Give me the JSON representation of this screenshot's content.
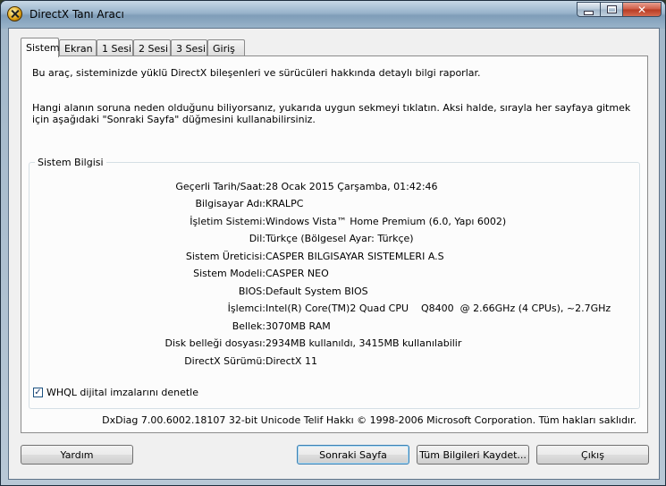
{
  "window": {
    "title": "DirectX Tanı Aracı"
  },
  "tabs": [
    {
      "label": "Sistem",
      "active": true
    },
    {
      "label": "Ekran"
    },
    {
      "label": "1 Sesi"
    },
    {
      "label": "2 Sesi"
    },
    {
      "label": "3 Sesi"
    },
    {
      "label": "Giriş"
    }
  ],
  "intro": {
    "line1": "Bu araç, sisteminizde yüklü DirectX bileşenleri ve sürücüleri hakkında detaylı bilgi raporlar.",
    "line2": "Hangi alanın soruna neden olduğunu biliyorsanız, yukarıda uygun sekmeyi tıklatın.  Aksi halde, sırayla her sayfaya gitmek için aşağıdaki \"Sonraki Sayfa\" düğmesini kullanabilirsiniz."
  },
  "system_info": {
    "title": "Sistem Bilgisi",
    "rows": [
      {
        "label": "Geçerli Tarih/Saat:",
        "value": "28 Ocak 2015 Çarşamba, 01:42:46"
      },
      {
        "label": "Bilgisayar Adı:",
        "value": "KRALPC"
      },
      {
        "label": "İşletim Sistemi:",
        "value": "Windows Vista™ Home Premium (6.0, Yapı 6002)"
      },
      {
        "label": "Dil:",
        "value": "Türkçe (Bölgesel Ayar: Türkçe)"
      },
      {
        "label": "Sistem Üreticisi:",
        "value": "CASPER BILGISAYAR SISTEMLERI A.S"
      },
      {
        "label": "Sistem Modeli:",
        "value": "CASPER NEO"
      },
      {
        "label": "BIOS:",
        "value": "Default System BIOS"
      },
      {
        "label": "İşlemci:",
        "value": "Intel(R) Core(TM)2 Quad CPU    Q8400  @ 2.66GHz (4 CPUs), ~2.7GHz"
      },
      {
        "label": "Bellek:",
        "value": "3070MB RAM"
      },
      {
        "label": "Disk belleği dosyası:",
        "value": "2934MB kullanıldı, 3415MB kullanılabilir"
      },
      {
        "label": "DirectX Sürümü:",
        "value": "DirectX 11"
      }
    ]
  },
  "whql": {
    "label": "WHQL dijital imzalarını denetle",
    "checked": true
  },
  "copyright": "DxDiag 7.00.6002.18107 32-bit Unicode  Telif Hakkı © 1998-2006 Microsoft Corporation.  Tüm hakları saklıdır.",
  "buttons": {
    "help": "Yardım",
    "next": "Sonraki Sayfa",
    "save": "Tüm Bilgileri Kaydet...",
    "exit": "Çıkış"
  },
  "icons": {
    "app": "directx-icon",
    "minimize": "minimize-icon",
    "maximize": "maximize-icon",
    "close": "close-icon",
    "check": "✓"
  }
}
